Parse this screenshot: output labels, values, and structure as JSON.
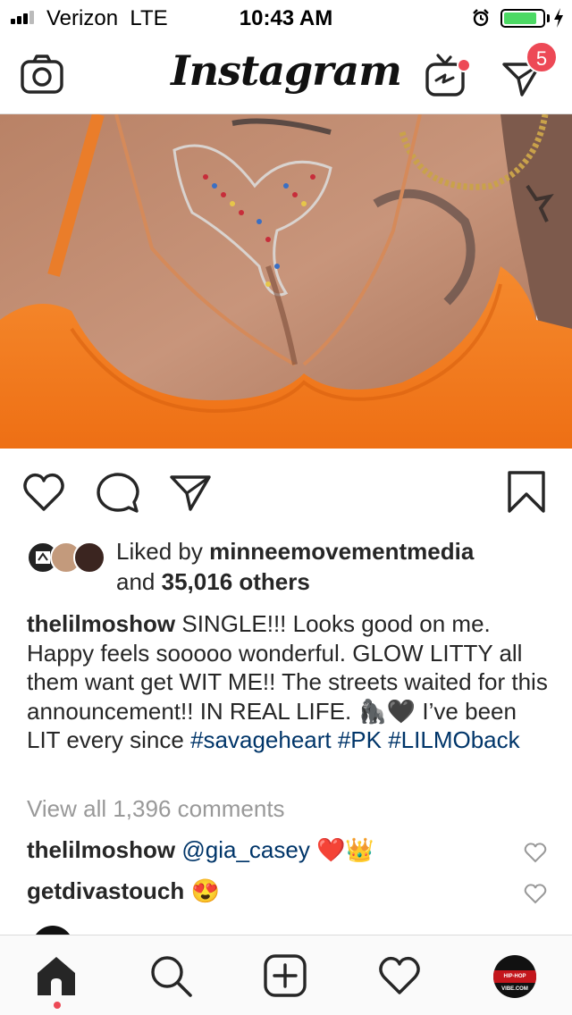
{
  "status_bar": {
    "carrier": "Verizon",
    "network": "LTE",
    "time": "10:43 AM",
    "battery_level": 0.85
  },
  "header": {
    "logo_text": "Instagram",
    "direct_badge_count": "5"
  },
  "post": {
    "likes": {
      "prefix": "Liked by",
      "first_liker": "minneemovementmedia",
      "and_text": "and",
      "others_text": "35,016 others"
    },
    "caption": {
      "username": "thelilmoshow",
      "text": "SINGLE!!! Looks good on me. Happy feels sooooo wonderful. GLOW LITTY all them want get WIT ME!! The streets waited for this announcement!! IN REAL LIFE. 🦍🖤 I’ve been LIT every since",
      "hashtags": "#savageheart #PK #LILMOback"
    },
    "view_all_comments": "View all 1,396 comments",
    "comments": [
      {
        "username": "thelilmoshow",
        "text": "@gia_casey ❤️👑"
      },
      {
        "username": "getdivastouch",
        "text": "😍"
      }
    ]
  },
  "bottom_nav": {
    "profile_avatar_text": "HIP-HOP VIBE.COM"
  },
  "colors": {
    "badge": "#ed4956",
    "link": "#003569",
    "muted": "#999999",
    "orange": "#f07a1e"
  }
}
